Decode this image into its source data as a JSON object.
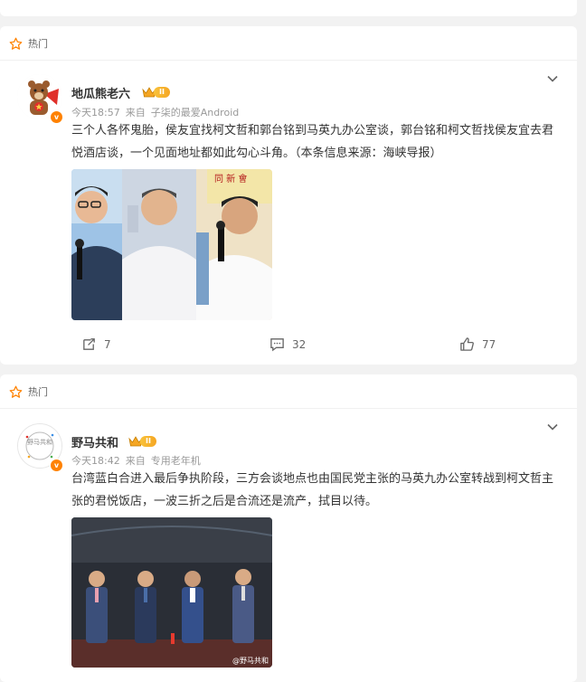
{
  "feed": {
    "hot_label": "热门",
    "posts": [
      {
        "author": "地瓜熊老六",
        "level": "II",
        "time": "今天18:57",
        "source_prefix": "来自",
        "source": "子柒的最爱Android",
        "text": "三个人各怀鬼胎，侯友宜找柯文哲和郭台铭到马英九办公室谈，郭台铭和柯文哲找侯友宜去君悦酒店谈，一个见面地址都如此勾心斗角。（本条信息来源：海峡导报）",
        "repost_count": "7",
        "comment_count": "32",
        "like_count": "77"
      },
      {
        "author": "野马共和",
        "level": "II",
        "time": "今天18:42",
        "source_prefix": "来自",
        "source": "专用老年机",
        "text": "台湾蓝白合进入最后争执阶段，三方会谈地点也由国民党主张的马英九办公室转战到柯文哲主张的君悦饭店，一波三折之后是合流还是流产，拭目以待。",
        "avatar_text": "野马共和",
        "watermark": "@野马共和"
      }
    ]
  },
  "colors": {
    "accent": "#ff8200",
    "crown": "#f5a623"
  }
}
